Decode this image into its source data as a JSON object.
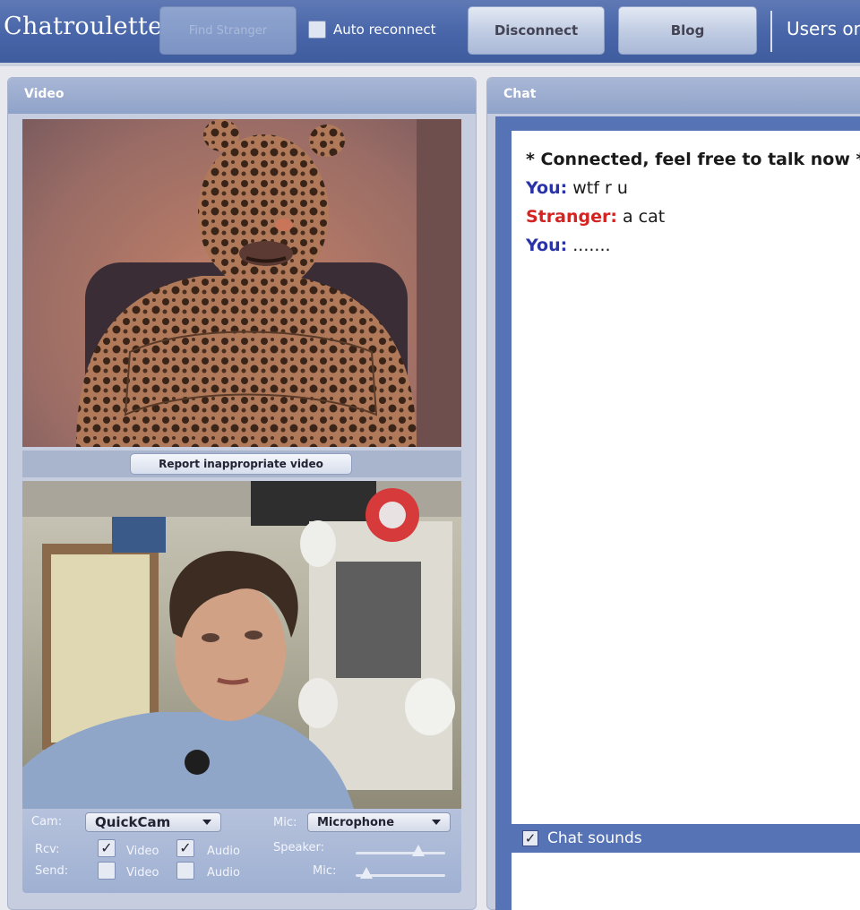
{
  "header": {
    "logo": "Chatroulette",
    "find_stranger": "Find Stranger",
    "auto_reconnect": "Auto reconnect",
    "disconnect": "Disconnect",
    "blog": "Blog",
    "users_online": "Users on"
  },
  "video": {
    "title": "Video",
    "report_label": "Report inappropriate video",
    "controls": {
      "cam_label": "Cam:",
      "cam_value": "QuickCam",
      "mic_label": "Mic:",
      "mic_value": "Microphone",
      "rcv_label": "Rcv:",
      "send_label": "Send:",
      "video_label": "Video",
      "audio_label": "Audio",
      "speaker_label": "Speaker:",
      "mic_slider_label": "Mic:",
      "rcv_video_checked": true,
      "rcv_audio_checked": true,
      "send_video_checked": false,
      "send_audio_checked": false,
      "speaker_level": 0.7,
      "mic_level": 0.12
    }
  },
  "chat": {
    "title": "Chat",
    "messages": [
      {
        "speaker": "",
        "text": "* Connected, feel free to talk now *"
      },
      {
        "speaker": "You:",
        "text": "wtf r u"
      },
      {
        "speaker": "Stranger:",
        "text": "a cat"
      },
      {
        "speaker": "You:",
        "text": "......."
      }
    ],
    "sounds_label": "Chat sounds",
    "sounds_checked": true
  },
  "colors": {
    "accent": "#4765a8",
    "you": "#2a32a8",
    "stranger": "#d42422"
  }
}
